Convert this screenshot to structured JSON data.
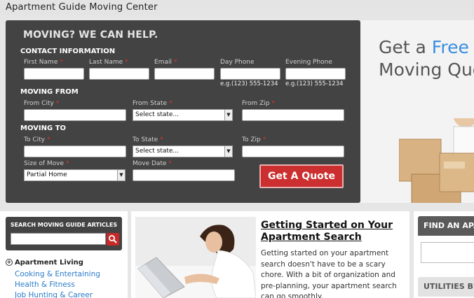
{
  "header": {
    "site_title": "Apartment Guide Moving Center"
  },
  "form": {
    "headline": "MOVING? WE CAN HELP.",
    "contact_title": "CONTACT INFORMATION",
    "first_name_label": "First Name",
    "last_name_label": "Last Name",
    "email_label": "Email",
    "day_phone_label": "Day Phone",
    "evening_phone_label": "Evening Phone",
    "phone_hint": "e.g.(123) 555-1234",
    "required_mark": "*",
    "moving_from_title": "MOVING FROM",
    "from_city_label": "From City",
    "from_state_label": "From State",
    "from_zip_label": "From Zip",
    "from_state_value": "Select state...",
    "moving_to_title": "MOVING TO",
    "to_city_label": "To City",
    "to_state_label": "To State",
    "to_zip_label": "To Zip",
    "to_state_value": "Select state...",
    "size_label": "Size of Move",
    "size_value": "Partial Home",
    "move_date_label": "Move Date",
    "submit_label": "Get A Quote"
  },
  "hero": {
    "line1_prefix": "Get a ",
    "line1_highlight": "Free",
    "line2": "Moving Quot"
  },
  "search": {
    "title": "SEARCH MOVING GUIDE ARTICLES"
  },
  "categories": {
    "heading": "Apartment Living",
    "links": [
      "Cooking & Entertaining",
      "Health & Fitness",
      "Job Hunting & Career"
    ]
  },
  "article": {
    "title": "Getting Started on Your Apartment Search",
    "body": "Getting started on your apartment search doesn't have to be a scary chore. With a bit of organization and pre-planning, your apartment search can go smoothly."
  },
  "sidebar": {
    "find_title": "FIND AN APA",
    "utilities_title": "UTILITIES BU"
  },
  "colors": {
    "panel": "#434343",
    "accent_red": "#cc2f2f",
    "link_blue": "#2a7bc9",
    "free_blue": "#3a8ee0"
  },
  "icons": {
    "search": "magnifier-icon",
    "expand": "plus-circle-icon",
    "dropdown": "chevron-down-icon"
  }
}
